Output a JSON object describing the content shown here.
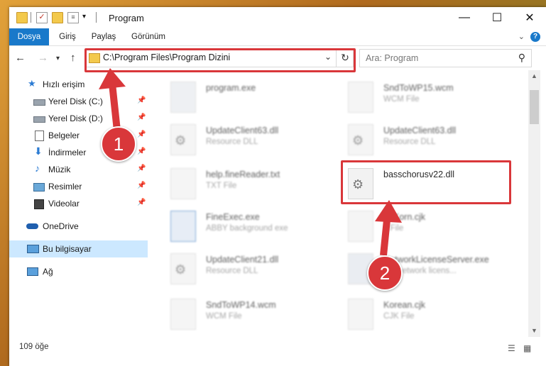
{
  "window": {
    "title": "Program"
  },
  "ribbon": {
    "tabs": [
      "Dosya",
      "Giriş",
      "Paylaş",
      "Görünüm"
    ]
  },
  "address": {
    "path": "C:\\Program Files\\Program Dizini"
  },
  "search": {
    "placeholder": "Ara: Program"
  },
  "sidebar": {
    "items": [
      {
        "label": "Hızlı erişim",
        "icon": "star-icon"
      },
      {
        "label": "Yerel Disk (C:)",
        "icon": "drive-icon",
        "pinned": true
      },
      {
        "label": "Yerel Disk (D:)",
        "icon": "drive-icon",
        "pinned": true
      },
      {
        "label": "Belgeler",
        "icon": "document-icon",
        "pinned": true
      },
      {
        "label": "İndirmeler",
        "icon": "download-icon",
        "pinned": true
      },
      {
        "label": "Müzik",
        "icon": "music-icon",
        "pinned": true
      },
      {
        "label": "Resimler",
        "icon": "pictures-icon",
        "pinned": true
      },
      {
        "label": "Videolar",
        "icon": "video-icon",
        "pinned": true
      },
      {
        "label": "OneDrive",
        "icon": "cloud-icon"
      },
      {
        "label": "Bu bilgisayar",
        "icon": "computer-icon",
        "selected": true
      },
      {
        "label": "Ağ",
        "icon": "network-icon"
      }
    ]
  },
  "files": {
    "left": [
      {
        "name": "program.exe",
        "type": ""
      },
      {
        "name": "UpdateClient63.dll",
        "type": "Resource DLL"
      },
      {
        "name": "help.fineReader.txt",
        "type": "TXT File"
      },
      {
        "name": "FineExec.exe",
        "type": "ABBY background exe"
      },
      {
        "name": "UpdateClient21.dll",
        "type": "Resource DLL"
      },
      {
        "name": "SndToWP14.wcm",
        "type": "WCM File"
      }
    ],
    "right": [
      {
        "name": "SndToWP15.wcm",
        "type": "WCM File"
      },
      {
        "name": "UpdateClient63.dll",
        "type": "Resource DLL"
      },
      {
        "name": "basschorusv22.dll",
        "type": ""
      },
      {
        "name": "...tKorn.cjk",
        "type": "...File"
      },
      {
        "name": "NetworkLicenseServer.exe",
        "type": "...Y network licens..."
      },
      {
        "name": "Korean.cjk",
        "type": "CJK File"
      }
    ]
  },
  "status": {
    "count": "109 öğe"
  },
  "annotations": {
    "step1": "1",
    "step2": "2",
    "color": "#d9373a"
  }
}
